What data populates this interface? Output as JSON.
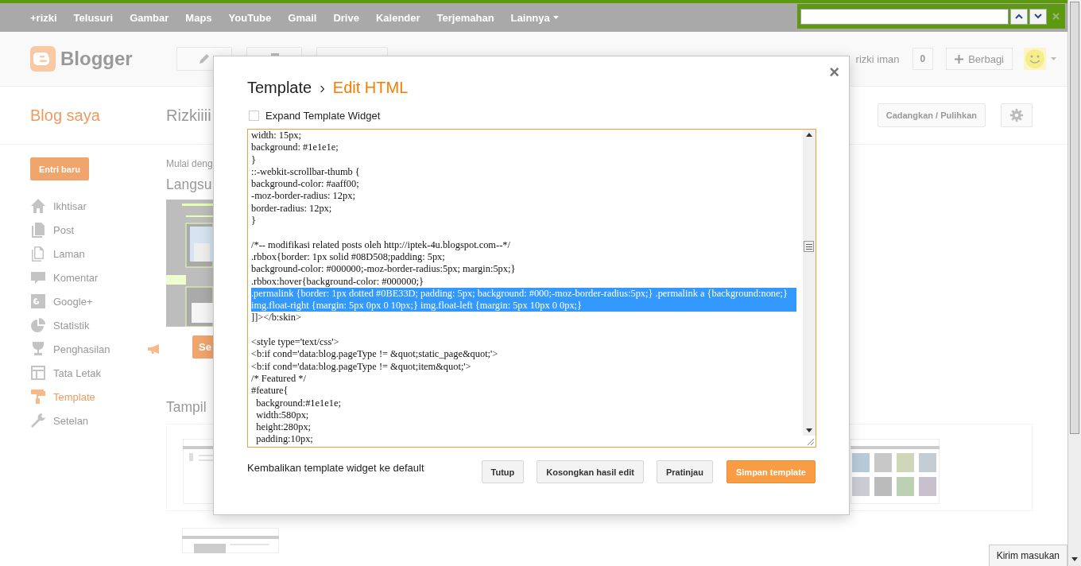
{
  "google_bar": {
    "links": [
      {
        "label": "+rizki",
        "kind": "link"
      },
      {
        "label": "Telusuri",
        "kind": "link"
      },
      {
        "label": "Gambar",
        "kind": "link"
      },
      {
        "label": "Maps",
        "kind": "link"
      },
      {
        "label": "YouTube",
        "kind": "link"
      },
      {
        "label": "Gmail",
        "kind": "link"
      },
      {
        "label": "Drive",
        "kind": "link"
      },
      {
        "label": "Kalender",
        "kind": "link"
      },
      {
        "label": "Terjemahan",
        "kind": "link"
      },
      {
        "label": "Lainnya",
        "kind": "menu"
      }
    ]
  },
  "header": {
    "logo": "Blogger",
    "user": "rizki iman",
    "notification_count": "0",
    "share_button": "Berbagi"
  },
  "blog_bar": {
    "title": "Blog saya",
    "blog_name": "Rizkiiii",
    "backup_button": "Cadangkan / Pulihkan"
  },
  "sidebar": {
    "new_post_button": "Entri baru",
    "items": [
      {
        "label": "Ikhtisar",
        "selected": false
      },
      {
        "label": "Post",
        "selected": false
      },
      {
        "label": "Laman",
        "selected": false
      },
      {
        "label": "Komentar",
        "selected": false
      },
      {
        "label": "Google+",
        "selected": false
      },
      {
        "label": "Statistik",
        "selected": false
      },
      {
        "label": "Penghasilan",
        "selected": false
      },
      {
        "label": "Tata Letak",
        "selected": false
      },
      {
        "label": "Template",
        "selected": true
      },
      {
        "label": "Setelan",
        "selected": false
      }
    ]
  },
  "content": {
    "intro": "Mulai deng",
    "live_heading": "Langsu",
    "apply_button": "Se",
    "gallery_heading": "Tampil"
  },
  "dialog": {
    "breadcrumb": "Template",
    "separator": "›",
    "title": "Edit HTML",
    "close": "×",
    "expand_widget": {
      "label": "Expand Template Widget",
      "checked": false
    },
    "code_lines": [
      {
        "kind": "code",
        "text": "width: 15px;",
        "selected": false
      },
      {
        "kind": "code",
        "text": "background: #1e1e1e;",
        "selected": false
      },
      {
        "kind": "code",
        "text": "}",
        "selected": false
      },
      {
        "kind": "code",
        "text": "::-webkit-scrollbar-thumb {",
        "selected": false
      },
      {
        "kind": "code",
        "text": "background-color: #aaff00;",
        "selected": false
      },
      {
        "kind": "code",
        "text": "-moz-border-radius: 12px;",
        "selected": false
      },
      {
        "kind": "code",
        "text": "border-radius: 12px;",
        "selected": false
      },
      {
        "kind": "code",
        "text": "}",
        "selected": false
      },
      {
        "kind": "blank"
      },
      {
        "kind": "code",
        "text": "/*-- modifikasi related posts oleh http://iptek-4u.blogspot.com--*/",
        "selected": false
      },
      {
        "kind": "code",
        "text": ".rbbox{border: 1px solid #08D508;padding: 5px;",
        "selected": false
      },
      {
        "kind": "code",
        "text": "background-color: #000000;-moz-border-radius:5px; margin:5px;}",
        "selected": false
      },
      {
        "kind": "code",
        "text": ".rbbox:hover{background-color: #000000;}",
        "selected": false
      },
      {
        "kind": "code",
        "text": ".permalink {border: 1px dotted #0BE33D; padding: 5px; background: #000;-moz-border-radius:5px;} .permalink a {background:none;} img.float-right {margin: 5px 0px 0 10px;} img.float-left {margin: 5px 10px 0 0px;}",
        "selected": true
      },
      {
        "kind": "code",
        "text": "]]></b:skin>",
        "selected": false
      },
      {
        "kind": "blank"
      },
      {
        "kind": "code",
        "text": "<style type='text/css'>",
        "selected": false
      },
      {
        "kind": "code",
        "text": "<b:if cond='data:blog.pageType != &quot;static_page&quot;'>",
        "selected": false
      },
      {
        "kind": "code",
        "text": "<b:if cond='data:blog.pageType != &quot;item&quot;'>",
        "selected": false
      },
      {
        "kind": "code",
        "text": "/* Featured */",
        "selected": false
      },
      {
        "kind": "code",
        "text": "#feature{",
        "selected": false
      },
      {
        "kind": "code",
        "text": "  background:#1e1e1e;",
        "selected": false
      },
      {
        "kind": "code",
        "text": "  width:580px;",
        "selected": false
      },
      {
        "kind": "code",
        "text": "  height:280px;",
        "selected": false
      },
      {
        "kind": "code",
        "text": "  padding:10px;",
        "selected": false
      }
    ],
    "reset_link": "Kembalikan template widget ke default",
    "buttons": [
      {
        "label": "Tutup",
        "kind": "default"
      },
      {
        "label": "Kosongkan hasil edit",
        "kind": "default"
      },
      {
        "label": "Pratinjau",
        "kind": "default"
      },
      {
        "label": "Simpan template",
        "kind": "primary"
      }
    ]
  },
  "feedback_button": "Kirim masukan"
}
